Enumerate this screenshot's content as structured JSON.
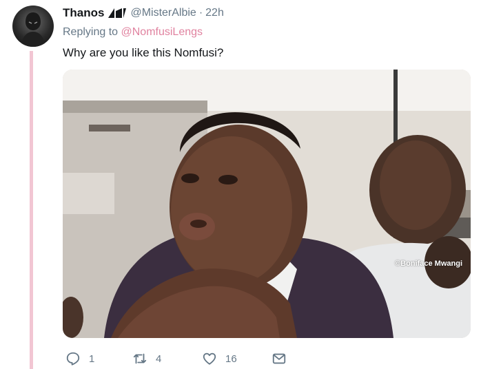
{
  "tweet": {
    "author_name": "Thanos",
    "handle": "@MisterAlbie",
    "separator": "·",
    "time": "22h",
    "replying_prefix": "Replying to",
    "replying_to": "@NomfusiLengs",
    "text": "Why are you like this Nomfusi?",
    "image_credit": "©Boniface Mwangi"
  },
  "actions": {
    "reply_count": "1",
    "retweet_count": "4",
    "like_count": "16"
  },
  "colors": {
    "thread_line": "#f2c6d3",
    "mention": "#e0829f",
    "muted": "#657786"
  },
  "icons": [
    "reply-icon",
    "retweet-icon",
    "like-icon",
    "dm-icon"
  ]
}
